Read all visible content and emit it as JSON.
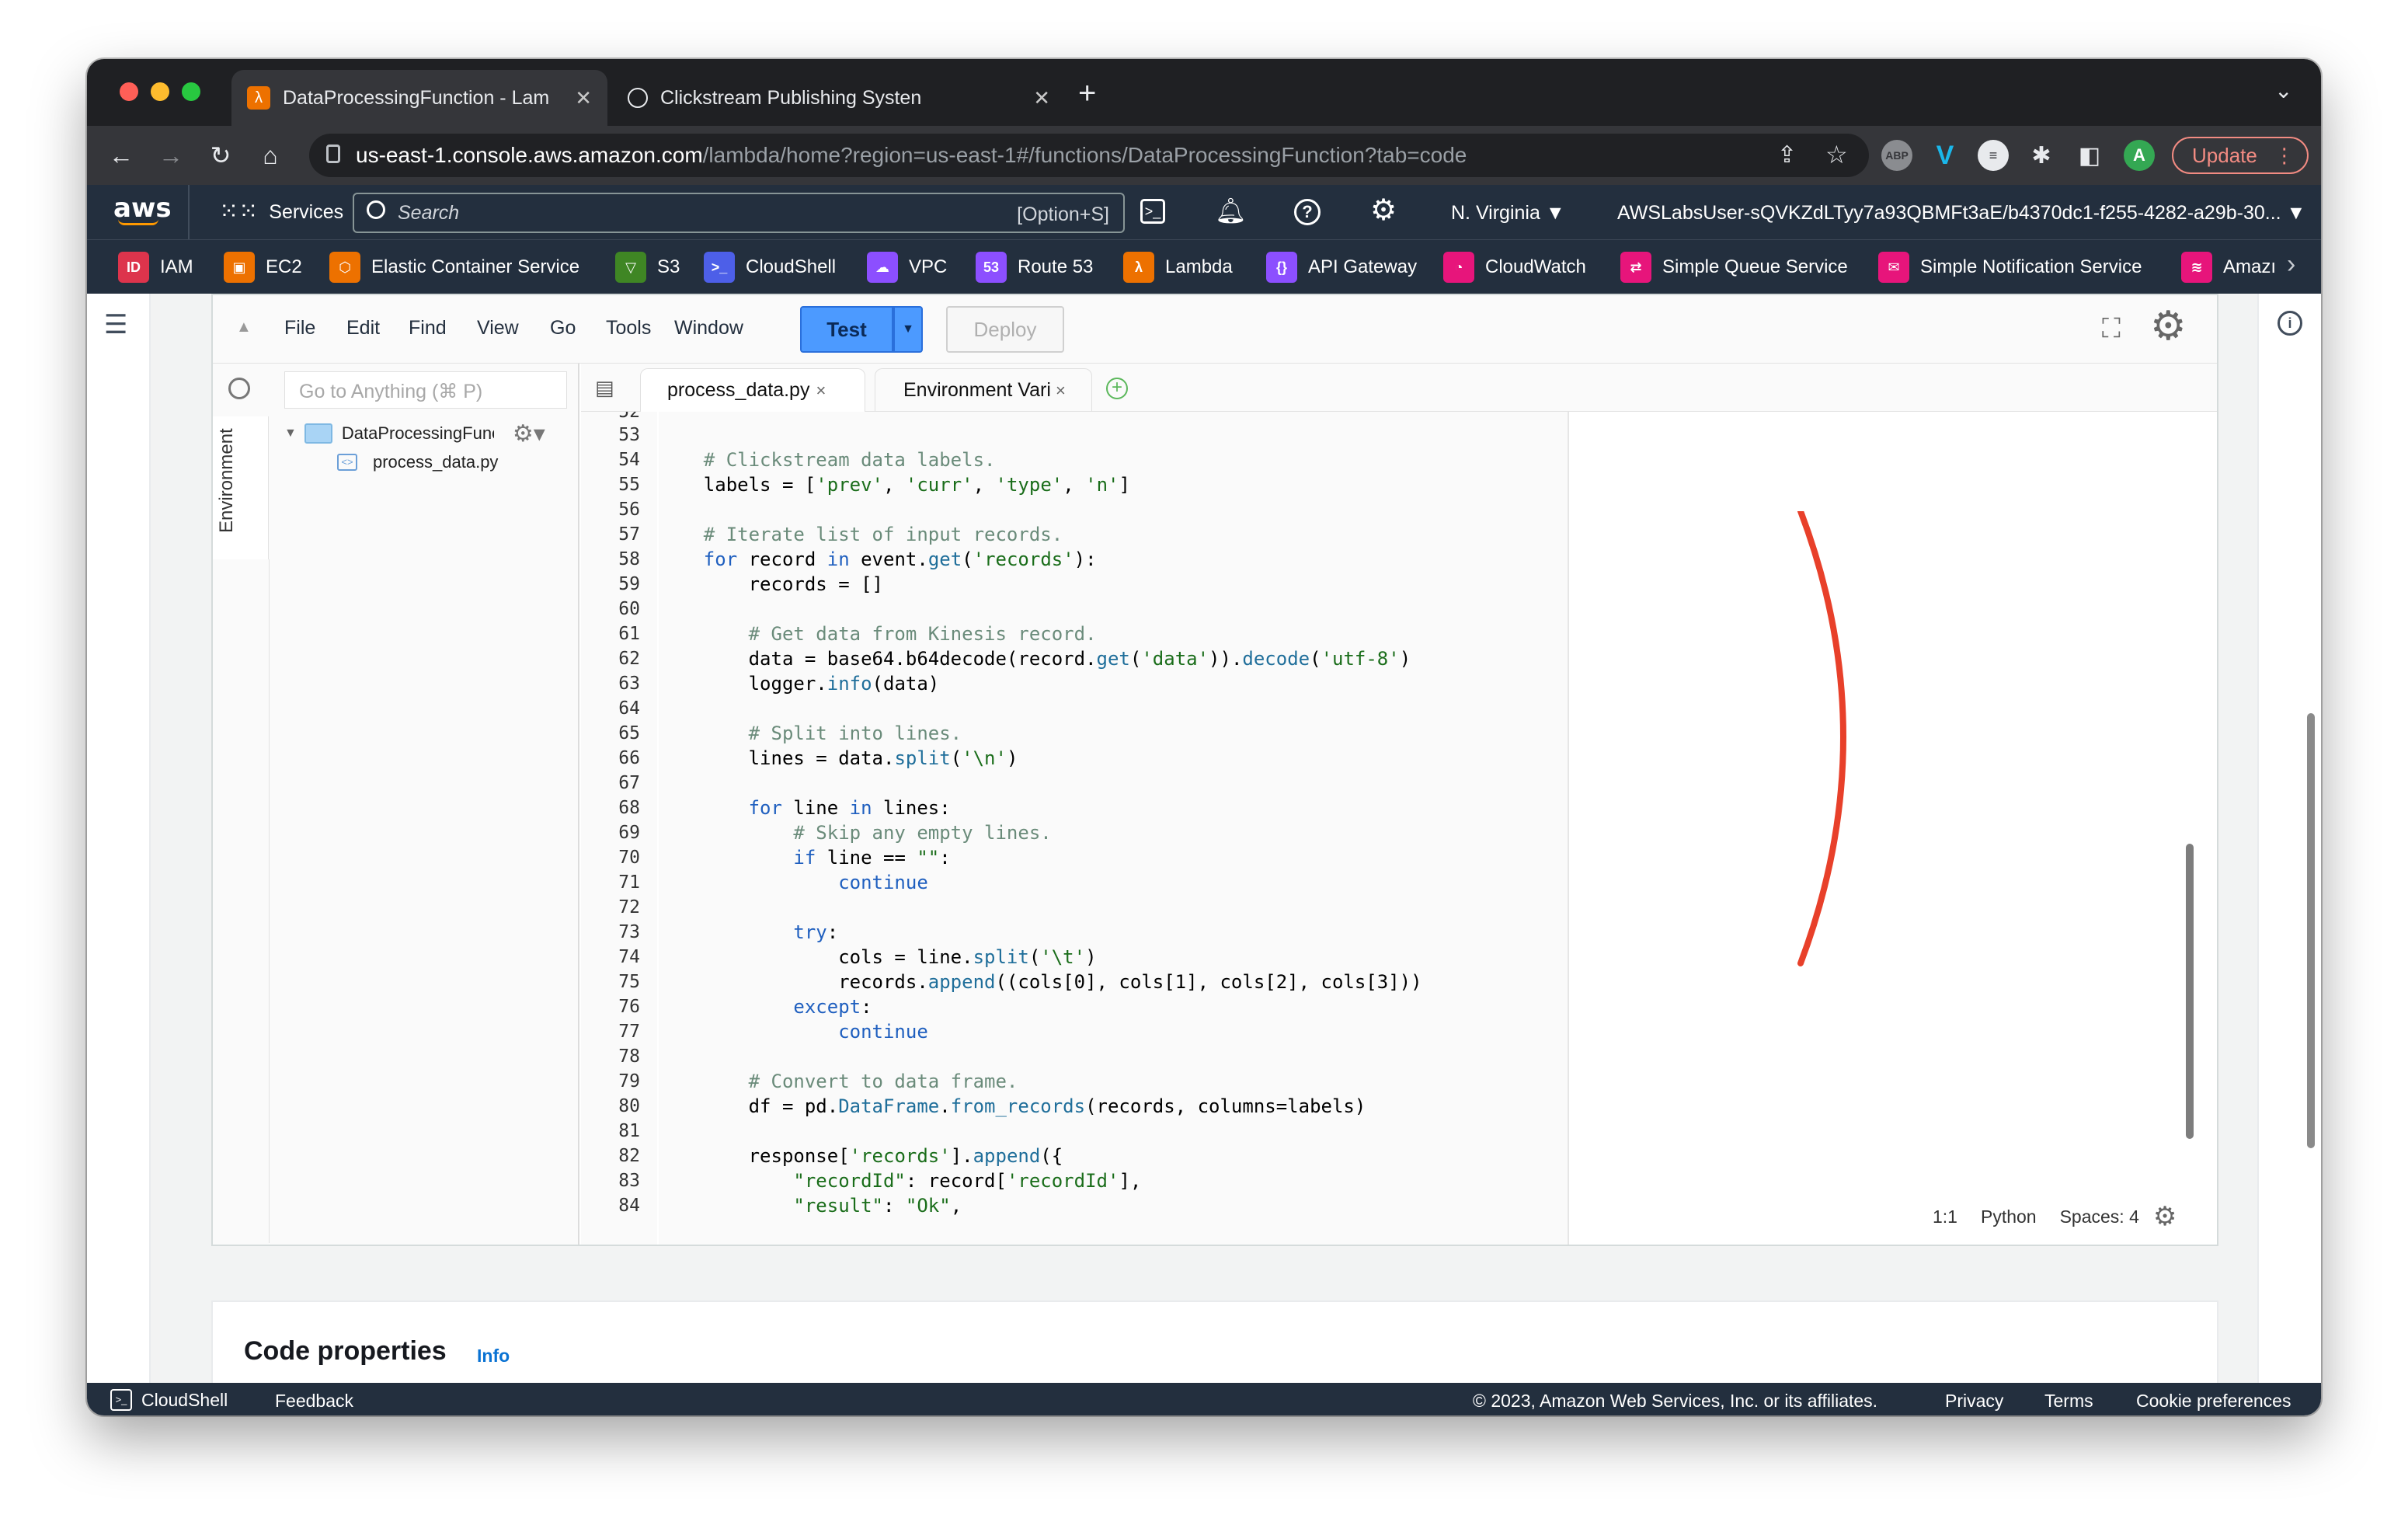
{
  "tabs": [
    {
      "title": "DataProcessingFunction - Lam",
      "icon": "lambda-icon",
      "active": true
    },
    {
      "title": "Clickstream Publishing Systen",
      "icon": "globe-icon",
      "active": false
    }
  ],
  "address": {
    "host": "us-east-1.console.aws.amazon.com",
    "path": "/lambda/home?region=us-east-1#/functions/DataProcessingFunction?tab=code"
  },
  "browser": {
    "update_label": "Update",
    "profile_initial": "A"
  },
  "aws": {
    "logo": "aws",
    "services_label": "Services",
    "search_placeholder": "Search",
    "search_shortcut": "[Option+S]",
    "region": "N. Virginia ▼",
    "account": "AWSLabsUser-sQVKZdLTyy7a93QBMFt3aE/b4370dc1-f255-4282-a29b-30... ▼"
  },
  "services": [
    {
      "label": "IAM",
      "color": "#dd344c"
    },
    {
      "label": "EC2",
      "color": "#ed7100"
    },
    {
      "label": "Elastic Container Service",
      "color": "#ed7100"
    },
    {
      "label": "S3",
      "color": "#3f8624"
    },
    {
      "label": "CloudShell",
      "color": "#4d5fe8"
    },
    {
      "label": "VPC",
      "color": "#8c4fff"
    },
    {
      "label": "Route 53",
      "color": "#8c4fff"
    },
    {
      "label": "Lambda",
      "color": "#ed7100"
    },
    {
      "label": "API Gateway",
      "color": "#8c4fff"
    },
    {
      "label": "CloudWatch",
      "color": "#e7157b"
    },
    {
      "label": "Simple Queue Service",
      "color": "#e7157b"
    },
    {
      "label": "Simple Notification Service",
      "color": "#e7157b"
    },
    {
      "label": "Amazı",
      "color": "#e7157b"
    }
  ],
  "ide": {
    "menu": [
      "File",
      "Edit",
      "Find",
      "View",
      "Go",
      "Tools",
      "Window"
    ],
    "test_label": "Test",
    "deploy_label": "Deploy",
    "goto_placeholder": "Go to Anything (⌘ P)",
    "env_label": "Environment",
    "tree": {
      "folder": "DataProcessingFunc",
      "file": "process_data.py"
    },
    "editor_tabs": [
      "process_data.py",
      "Environment Vari"
    ],
    "status": {
      "position": "1:1",
      "language": "Python",
      "spaces": "Spaces: 4"
    }
  },
  "code": {
    "first_line": 52,
    "lines": [
      "",
      "",
      "    # Clickstream data labels.",
      "    labels = ['prev', 'curr', 'type', 'n']",
      "",
      "    # Iterate list of input records.",
      "    for record in event.get('records'):",
      "        records = []",
      "",
      "        # Get data from Kinesis record.",
      "        data = base64.b64decode(record.get('data')).decode('utf-8')",
      "        logger.info(data)",
      "",
      "        # Split into lines.",
      "        lines = data.split('\\n')",
      "",
      "        for line in lines:",
      "            # Skip any empty lines.",
      "            if line == \"\":",
      "                continue",
      "",
      "            try:",
      "                cols = line.split('\\t')",
      "                records.append((cols[0], cols[1], cols[2], cols[3]))",
      "            except:",
      "                continue",
      "",
      "        # Convert to data frame.",
      "        df = pd.DataFrame.from_records(records, columns=labels)",
      "",
      "        response['records'].append({",
      "            \"recordId\": record['recordId'],",
      "            \"result\": \"Ok\","
    ]
  },
  "code_properties": {
    "title": "Code properties",
    "info": "Info"
  },
  "footer": {
    "cloudshell": "CloudShell",
    "feedback": "Feedback",
    "copyright": "© 2023, Amazon Web Services, Inc. or its affiliates.",
    "privacy": "Privacy",
    "terms": "Terms",
    "cookies": "Cookie preferences"
  },
  "annotation_color": "#e8402a"
}
